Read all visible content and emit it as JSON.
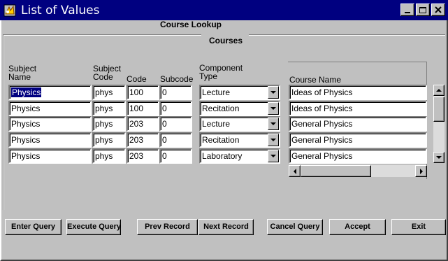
{
  "window": {
    "title": "List of Values",
    "minimize_symbol": "_",
    "close_symbol": "X"
  },
  "heading": "Course Lookup",
  "group_title": "Courses",
  "columns": {
    "subject_name": [
      "Subject",
      "Name"
    ],
    "subject_code": [
      "Subject",
      "Code"
    ],
    "code": "Code",
    "subcode": "Subcode",
    "component_type": [
      "Component",
      "Type"
    ],
    "course_name": "Course Name"
  },
  "rows": [
    {
      "subject_name": "Physics",
      "subject_code": "phys",
      "code": "100",
      "subcode": "0",
      "component_type": "Lecture",
      "course_name": "Ideas of Physics"
    },
    {
      "subject_name": "Physics",
      "subject_code": "phys",
      "code": "100",
      "subcode": "0",
      "component_type": "Recitation",
      "course_name": "Ideas of Physics"
    },
    {
      "subject_name": "Physics",
      "subject_code": "phys",
      "code": "203",
      "subcode": "0",
      "component_type": "Lecture",
      "course_name": "General Physics"
    },
    {
      "subject_name": "Physics",
      "subject_code": "phys",
      "code": "203",
      "subcode": "0",
      "component_type": "Recitation",
      "course_name": "General Physics"
    },
    {
      "subject_name": "Physics",
      "subject_code": "phys",
      "code": "203",
      "subcode": "0",
      "component_type": "Laboratory",
      "course_name": "General Physics"
    }
  ],
  "buttons": {
    "enter_query": "Enter Query",
    "execute_query": "Execute Query",
    "prev_record": "Prev Record",
    "next_record": "Next Record",
    "cancel_query": "Cancel Query",
    "accept": "Accept",
    "exit": "Exit"
  },
  "icons": [
    "app-icon",
    "minimize-icon",
    "maximize-icon",
    "close-icon",
    "dropdown-arrow-icon",
    "scroll-up-icon",
    "scroll-down-icon",
    "scroll-left-icon",
    "scroll-right-icon"
  ],
  "colors": {
    "titlebar": "#000080",
    "face": "#c0c0c0",
    "selection": "#000080"
  }
}
